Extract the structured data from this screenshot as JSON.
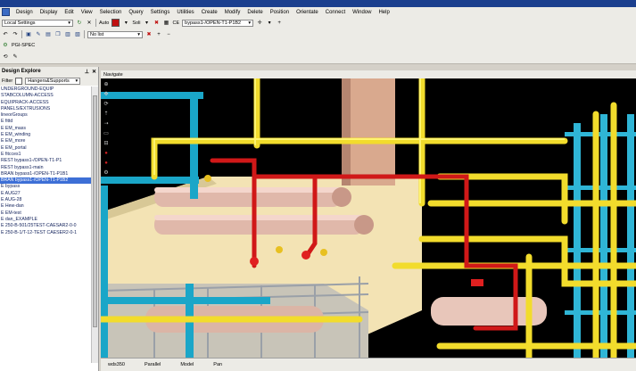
{
  "menu": [
    "Design",
    "Display",
    "Edit",
    "View",
    "Selection",
    "Query",
    "Settings",
    "Utilities",
    "Create",
    "Modify",
    "Delete",
    "Position",
    "Orientate",
    "Connect",
    "Window",
    "Help"
  ],
  "toolbar": {
    "local_settings": "Local Settings",
    "auto_label": "Auto",
    "style_label": "Soli",
    "ce_label": "CE",
    "ce_value": "bypass1-/OPEN-T1-P1B2",
    "no_list": "No list",
    "spec": "PGI-SPEC"
  },
  "explorer": {
    "title": "Design Explore",
    "pin_icon": "pin-icon",
    "close_icon": "close-icon",
    "filter_label": "Filter",
    "filter_value": "Hangers&Supports",
    "items": [
      "UNDERGROUND-EQUIP",
      "STABCOLUMN-ACCESS",
      "EQUIPRACK-ACCESS",
      "PANELS/EXTRUSIONS",
      "lineorGroups",
      "E fittd",
      "E EM_mass",
      "E EM_winding",
      "E EM_more",
      "E EM_portal",
      "E fitcces1",
      "REST bypass1-/OPEN-T1-P1",
      "REST bypass1-main",
      "BRAN bypass1-/OPEN-T1-P1B1",
      "BRAN bypass1-/OPEN-T1-P1B2",
      "E bypass",
      "E AUG27",
      "E AUG-28",
      "E Hew-dan",
      "E EM-test",
      "E dan_EXAMPLE",
      "E 250-B-501/25TEST-CAESAR2-0-0",
      "E 250-B-1/T-12-TEST CAESER2-0-1"
    ],
    "selected_index": 14
  },
  "viewport": {
    "tab_label": "Navigate"
  },
  "status": [
    "wds350",
    "Parallel",
    "Model",
    "Pan"
  ]
}
